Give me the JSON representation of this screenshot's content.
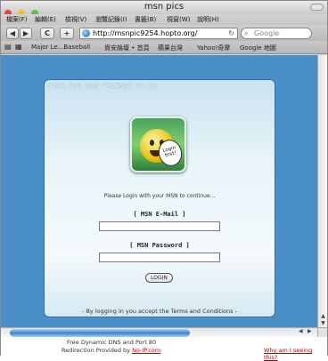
{
  "window": {
    "title": "msn pics"
  },
  "menu": [
    "檔案(F)",
    "編輯(E)",
    "檢視(V)",
    "瀏覽記錄(I)",
    "書籤(B)",
    "視窗(W)",
    "說明(H)"
  ],
  "toolbar": {
    "back": "◀",
    "forward": "▶",
    "reload": "C",
    "add": "+",
    "url": "http://msnpic9254.hopto.org/",
    "search_placeholder": "Google"
  },
  "bookmarks": [
    "Major Le...Baseball",
    "資安論壇 • 首頁",
    "蘋果台灣",
    "Yahoo!奇摩",
    "Google 地圖"
  ],
  "page": {
    "panel_title": "PICS FOR MSN FRIENDS v1.1c",
    "bubble_text": "Login first!",
    "prompt": "Please Login with your MSN to continue...",
    "email_label": "[ MSN E-Mail ]",
    "email_value": "",
    "password_label": "[ MSN Password ]",
    "password_value": "",
    "login_button": "LOGIN",
    "terms": "- By logging in you accept the Terms and Conditions -"
  },
  "status": {
    "line1": "Free Dynamic DNS and Port 80",
    "line2_prefix": "Redirection Provided by",
    "link": "No-IP.com",
    "why": "Why am I seeing this?"
  },
  "colors": {
    "page_bg": "#4a8fc8",
    "link": "#cc0000"
  }
}
